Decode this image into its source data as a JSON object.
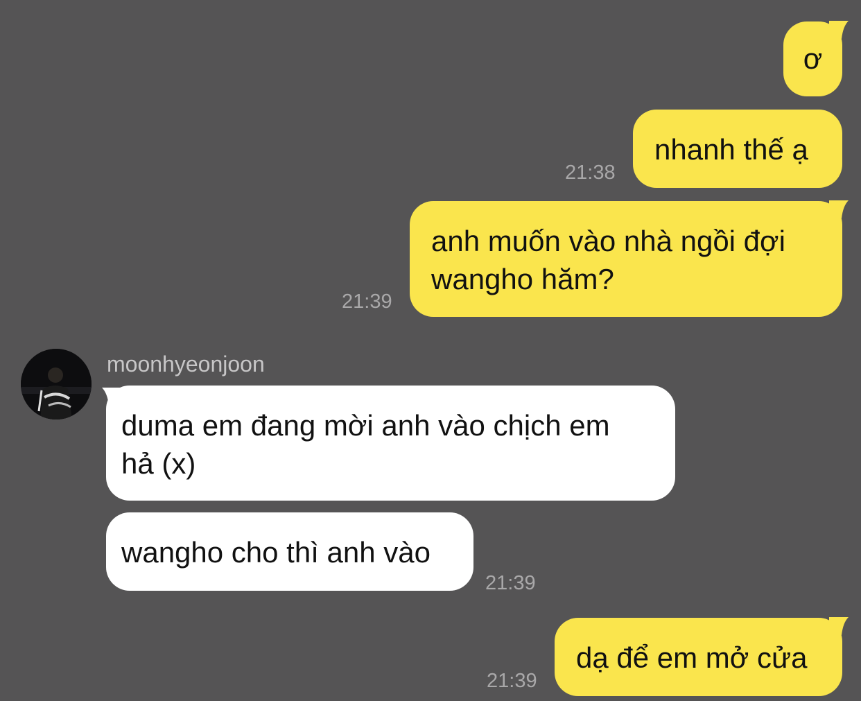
{
  "colors": {
    "background": "#555455",
    "my_bubble": "#FAE54D",
    "their_bubble": "#FFFFFF",
    "timestamp": "#A9A8A9",
    "sender_name": "#C7C6C7"
  },
  "messages": [
    {
      "side": "mine",
      "lines": [
        "ơ"
      ],
      "time": ""
    },
    {
      "side": "mine",
      "lines": [
        "nhanh thế ạ"
      ],
      "time": "21:38"
    },
    {
      "side": "mine",
      "lines": [
        "anh muốn vào nhà ngồi đợi",
        "wangho hăm?"
      ],
      "time": "21:39"
    },
    {
      "side": "theirs",
      "sender": "moonhyeonjoon",
      "lines": [
        "duma em đang mời anh vào chịch em",
        "hả (x)"
      ],
      "time": ""
    },
    {
      "side": "theirs",
      "lines": [
        "wangho cho thì anh vào"
      ],
      "time": "21:39"
    },
    {
      "side": "mine",
      "lines": [
        "dạ để em mở cửa"
      ],
      "time": "21:39"
    }
  ],
  "contact": {
    "name": "moonhyeonjoon",
    "avatar_icon": "profile-photo-avatar"
  }
}
